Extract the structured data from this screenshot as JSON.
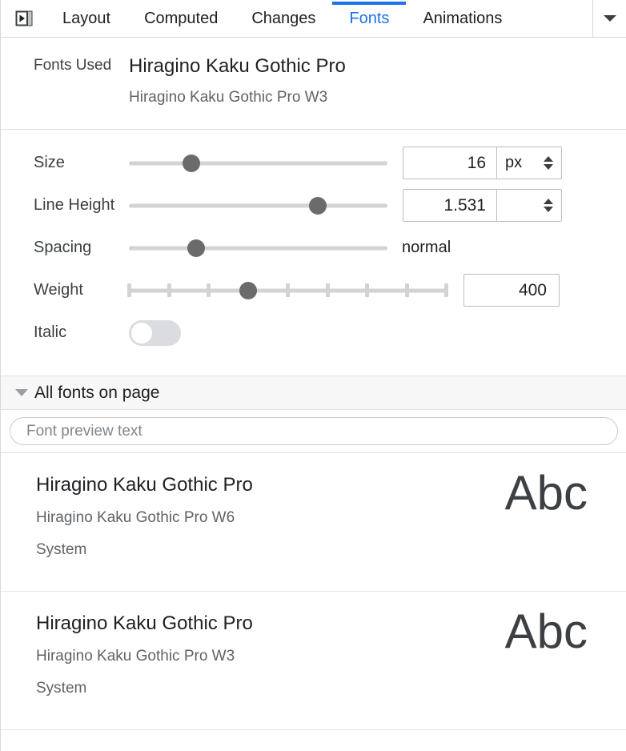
{
  "toolbar": {
    "dock_icon": "dock-panel-icon",
    "tabs": [
      {
        "label": "Layout",
        "active": false
      },
      {
        "label": "Computed",
        "active": false
      },
      {
        "label": "Changes",
        "active": false
      },
      {
        "label": "Fonts",
        "active": true
      },
      {
        "label": "Animations",
        "active": false
      }
    ],
    "overflow_icon": "chevron-down-icon",
    "active_tab_color": "#1a73e8"
  },
  "fonts_used": {
    "label": "Fonts Used",
    "family": "Hiragino Kaku Gothic Pro",
    "variant": "Hiragino Kaku Gothic Pro W3"
  },
  "controls": {
    "size": {
      "label": "Size",
      "value": "16",
      "unit": "px",
      "slider_percent": 24
    },
    "line_height": {
      "label": "Line Height",
      "value": "1.531",
      "unit": "",
      "slider_percent": 73
    },
    "spacing": {
      "label": "Spacing",
      "value": "normal",
      "slider_percent": 26
    },
    "weight": {
      "label": "Weight",
      "value": "400",
      "slider_percent": 37.5,
      "tick_count": 9
    },
    "italic": {
      "label": "Italic",
      "enabled": false
    }
  },
  "all_fonts": {
    "header": "All fonts on page",
    "expanded": true,
    "preview": {
      "placeholder": "Font preview text",
      "value": ""
    },
    "sample_text": "Abc",
    "rows": [
      {
        "family": "Hiragino Kaku Gothic Pro",
        "variant": "Hiragino Kaku Gothic Pro W6",
        "origin": "System"
      },
      {
        "family": "Hiragino Kaku Gothic Pro",
        "variant": "Hiragino Kaku Gothic Pro W3",
        "origin": "System"
      }
    ]
  }
}
